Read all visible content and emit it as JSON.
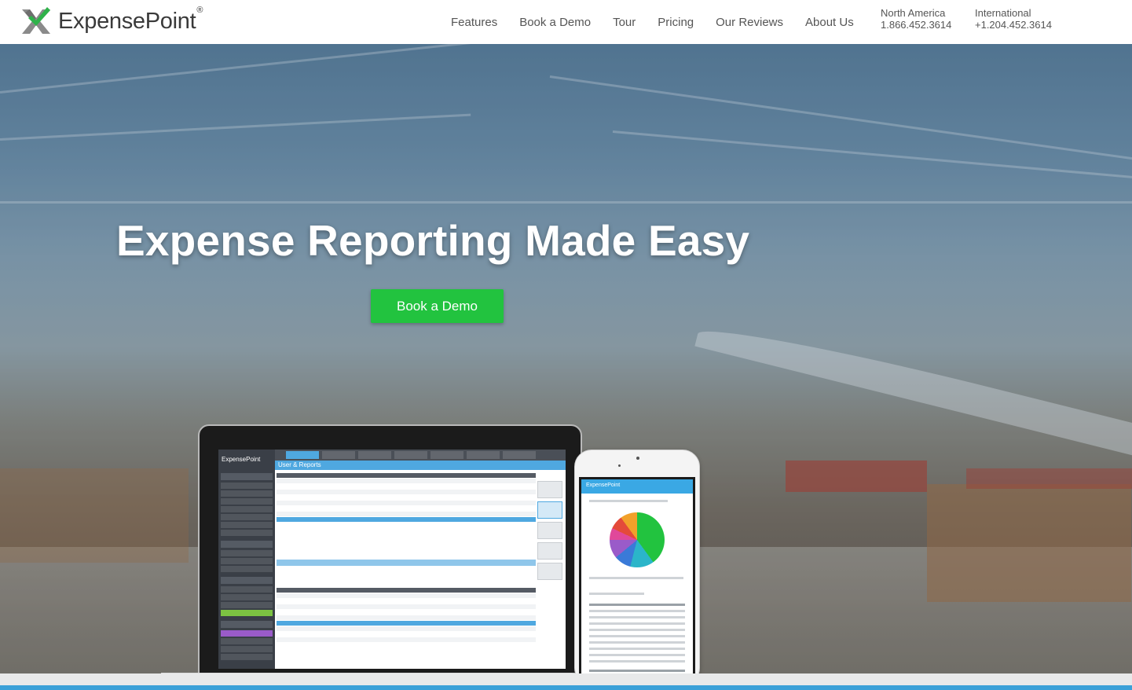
{
  "brand": {
    "name": "ExpensePoint",
    "registered_mark": "®",
    "accent_green": "#22c33f",
    "accent_blue": "#3aa0d8"
  },
  "nav": {
    "items": [
      {
        "label": "Features"
      },
      {
        "label": "Book a Demo"
      },
      {
        "label": "Tour"
      },
      {
        "label": "Pricing"
      },
      {
        "label": "Our Reviews"
      },
      {
        "label": "About Us"
      }
    ]
  },
  "contact": {
    "north_america": {
      "region": "North America",
      "number": "1.866.452.3614"
    },
    "international": {
      "region": "International",
      "number": "+1.204.452.3614"
    }
  },
  "hero": {
    "title": "Expense Reporting Made Easy",
    "cta_label": "Book a Demo"
  },
  "devices": {
    "laptop": {
      "app_logo": "ExpensePoint",
      "panel_title": "User & Reports"
    },
    "phone": {
      "app_logo": "ExpensePoint"
    }
  }
}
